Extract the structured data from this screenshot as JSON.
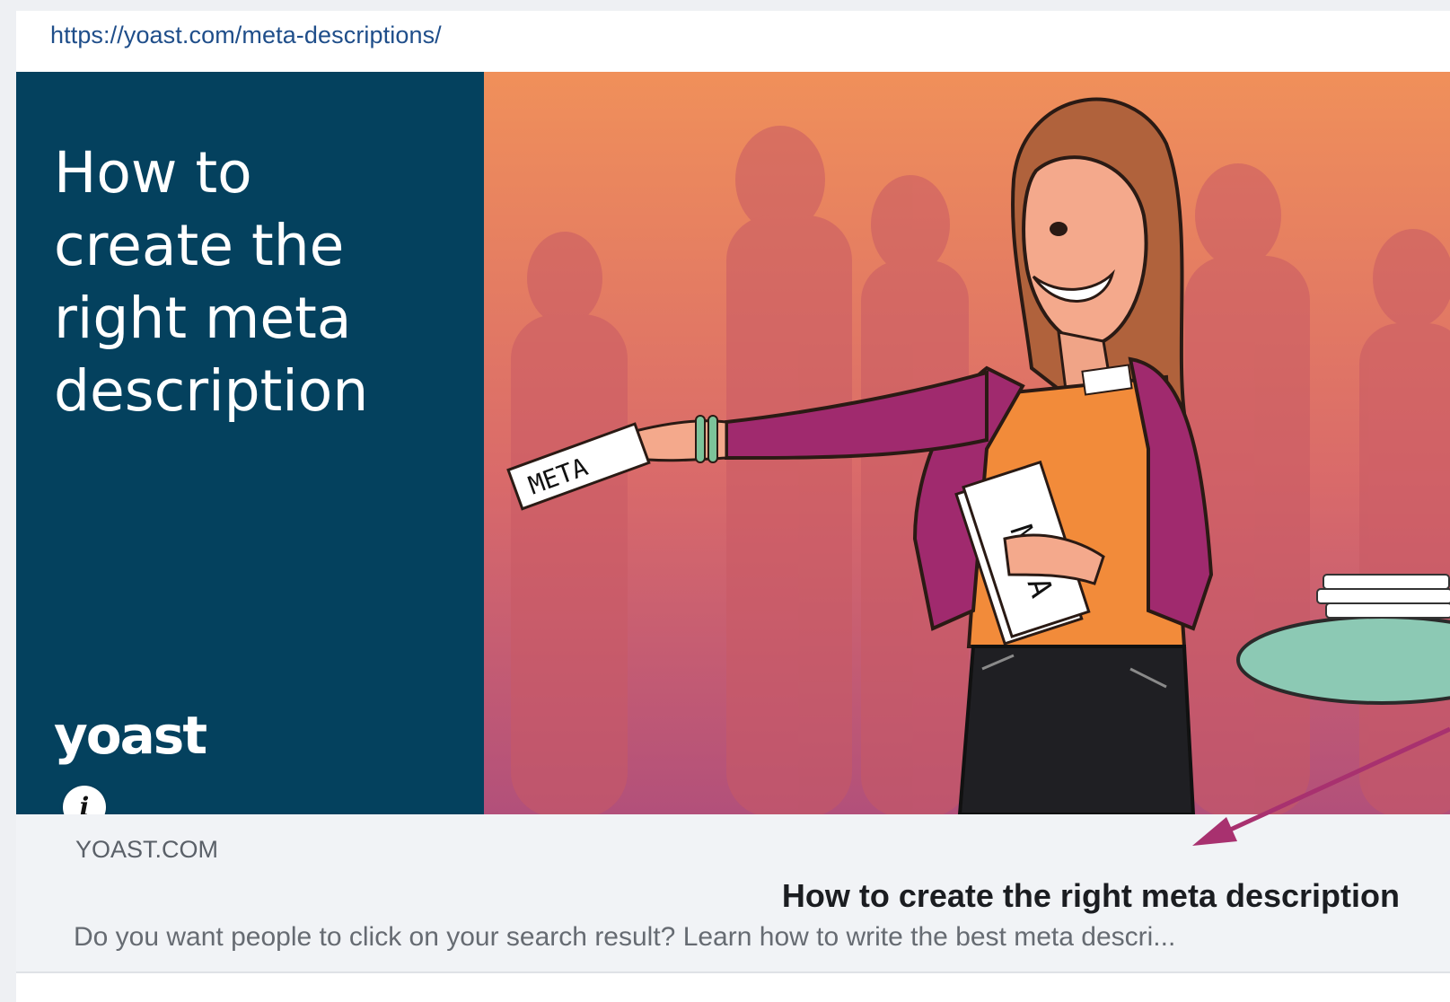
{
  "preview": {
    "url": "https://yoast.com/meta-descriptions/",
    "banner": {
      "headline_lines": [
        "How to",
        "create the",
        "right meta",
        "description"
      ],
      "logo_text": "yoast",
      "note_meta_hand": "META",
      "note_meta_stack": "META",
      "colors": {
        "panel": "#04415e",
        "background_top": "#f0905a",
        "background_bottom": "#b2507a",
        "jacket": "#a02a6e",
        "arrow": "#a8316f"
      }
    },
    "info_icon": "i",
    "domain": "YOAST.COM",
    "title": "How to create the right meta description",
    "description": "Do you want people to click on your search result? Learn how to write the best meta descri..."
  }
}
